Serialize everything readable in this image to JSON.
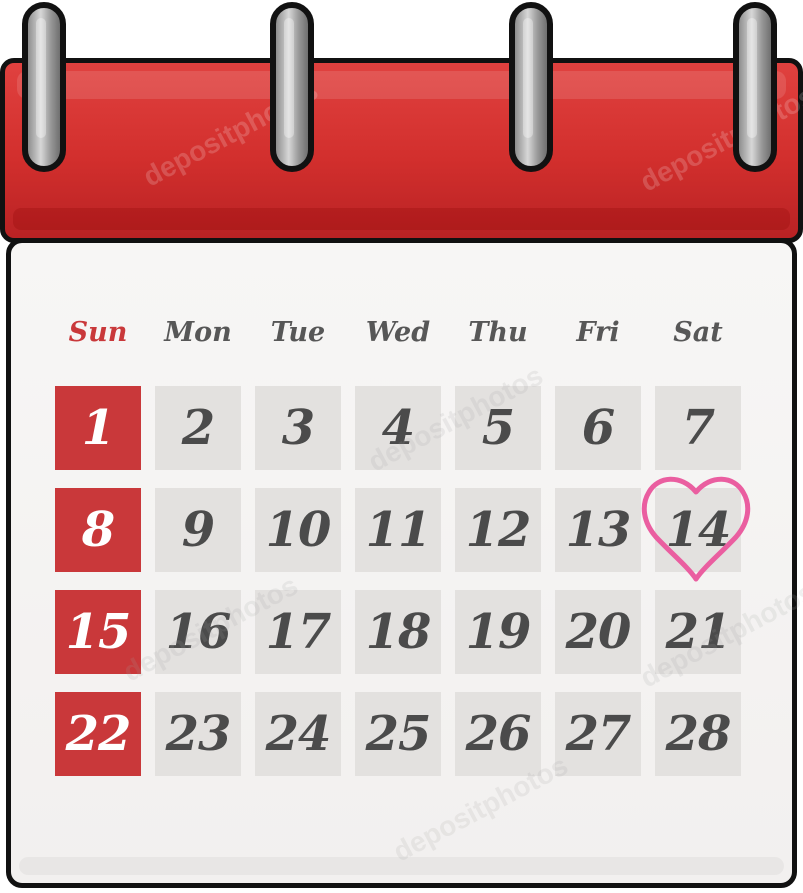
{
  "calendar": {
    "weekdays": [
      "Sun",
      "Mon",
      "Tue",
      "Wed",
      "Thu",
      "Fri",
      "Sat"
    ],
    "weeks": [
      [
        "1",
        "2",
        "3",
        "4",
        "5",
        "6",
        "7"
      ],
      [
        "8",
        "9",
        "10",
        "11",
        "12",
        "13",
        "14"
      ],
      [
        "15",
        "16",
        "17",
        "18",
        "19",
        "20",
        "21"
      ],
      [
        "22",
        "23",
        "24",
        "25",
        "26",
        "27",
        "28"
      ]
    ],
    "highlighted_day": "14",
    "marker": "heart-icon"
  },
  "watermark": {
    "text": "depositphotos"
  },
  "colors": {
    "header_red": "#d22f2d",
    "sunday_red": "#c9383a",
    "page_bg": "#f2f0ef",
    "cell_gray": "#e3e1df",
    "number_gray": "#4b4b4b",
    "weekday_gray": "#575757",
    "heart_pink": "#ea5ea0",
    "ring_gray": "#b8b8b8",
    "outline": "#111111"
  }
}
